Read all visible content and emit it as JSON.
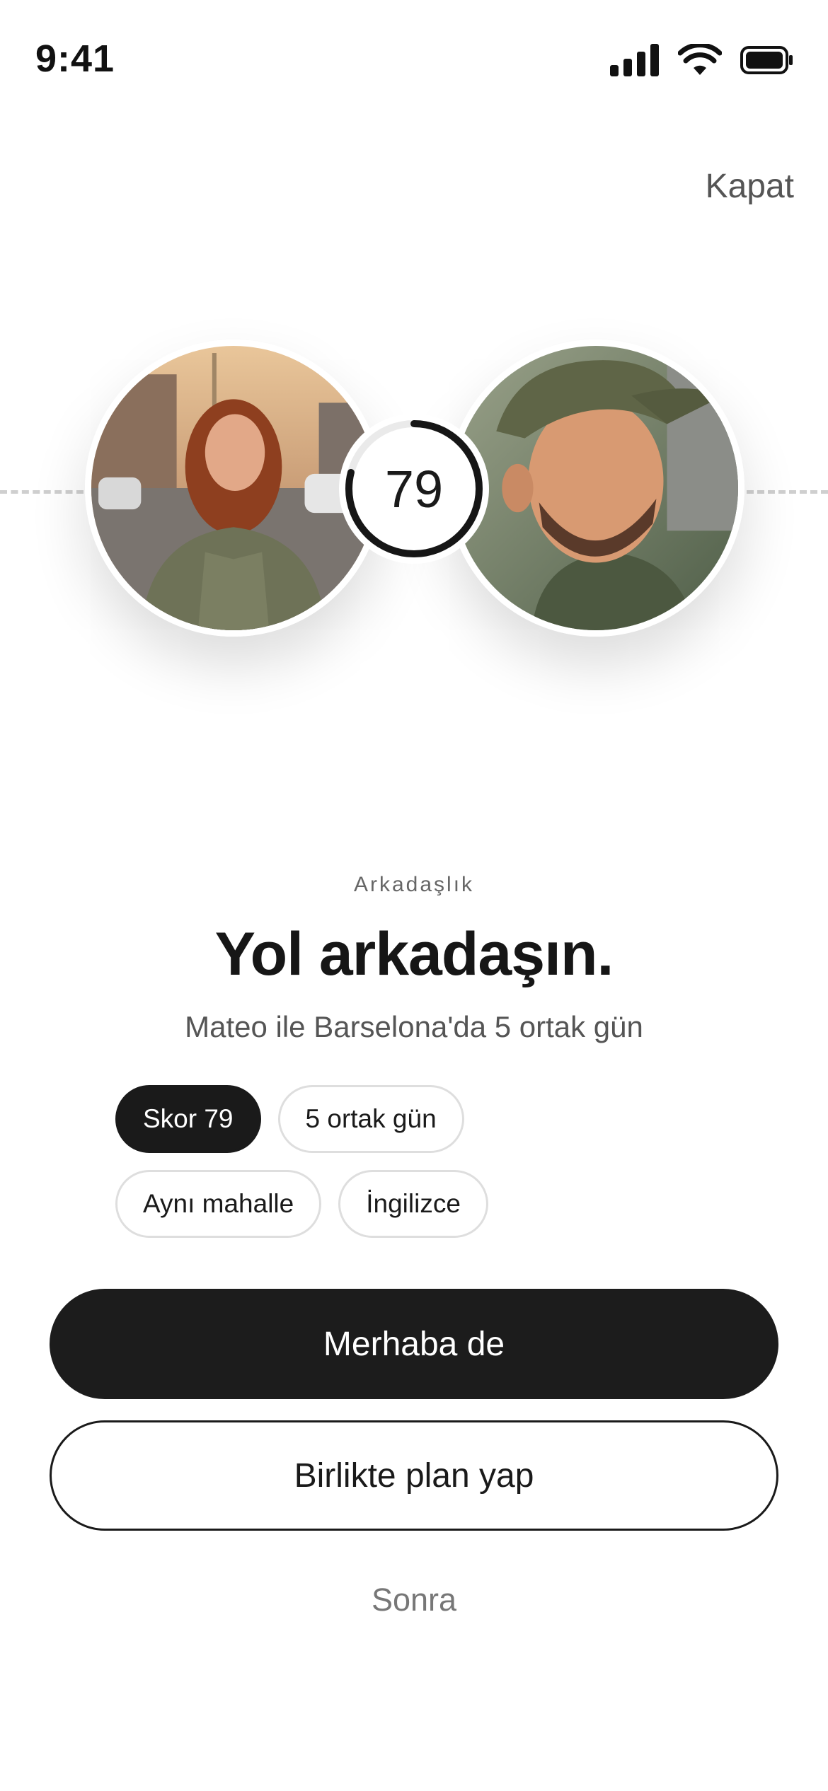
{
  "status_bar": {
    "time": "9:41",
    "icons": [
      "cellular-signal-icon",
      "wifi-icon",
      "battery-icon"
    ]
  },
  "header": {
    "close_label": "Kapat"
  },
  "match": {
    "score": "79",
    "score_fraction": 0.79,
    "left_avatar": "woman-photo",
    "right_avatar": "man-photo"
  },
  "content": {
    "eyebrow": "Arkadaşlık",
    "title": "Yol arkadaşın.",
    "subtitle": "Mateo ile Barselona'da 5 ortak gün",
    "chips": [
      {
        "label": "Skor 79",
        "style": "filled"
      },
      {
        "label": "5 ortak gün",
        "style": "outline"
      },
      {
        "label": "Aynı mahalle",
        "style": "outline"
      },
      {
        "label": "İngilizce",
        "style": "outline"
      }
    ]
  },
  "actions": {
    "primary_label": "Merhaba de",
    "secondary_label": "Birlikte plan yap",
    "later_label": "Sonra"
  },
  "colors": {
    "primary": "#1c1c1c",
    "background": "#ffffff",
    "muted_text": "#555555",
    "chip_border": "#dedede"
  }
}
